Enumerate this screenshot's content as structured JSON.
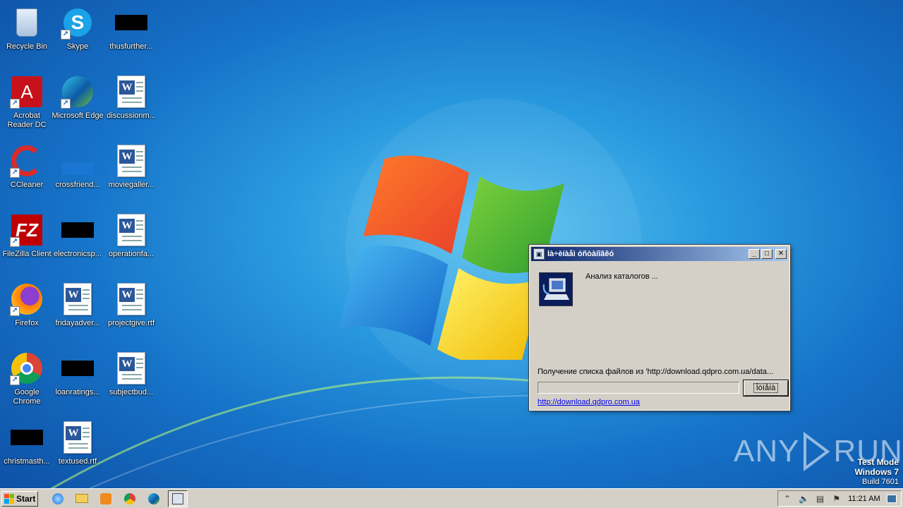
{
  "desktop": {
    "icons": [
      {
        "label": "Recycle Bin",
        "icon": "recycle-bin-icon"
      },
      {
        "label": "Skype",
        "icon": "skype-icon"
      },
      {
        "label": "thusfurther...",
        "icon": "blacked-out-file-icon"
      },
      {
        "label": "Acrobat Reader DC",
        "icon": "acrobat-icon"
      },
      {
        "label": "Microsoft Edge",
        "icon": "edge-icon"
      },
      {
        "label": "discussionm...",
        "icon": "word-doc-icon"
      },
      {
        "label": "CCleaner",
        "icon": "ccleaner-icon"
      },
      {
        "label": "crossfriend...",
        "icon": "folder-icon"
      },
      {
        "label": "moviegaller...",
        "icon": "word-doc-icon"
      },
      {
        "label": "FileZilla Client",
        "icon": "filezilla-icon"
      },
      {
        "label": "electronicsp...",
        "icon": "blacked-out-file-icon"
      },
      {
        "label": "operationfa...",
        "icon": "word-doc-icon"
      },
      {
        "label": "Firefox",
        "icon": "firefox-icon"
      },
      {
        "label": "fridayadver...",
        "icon": "word-doc-icon"
      },
      {
        "label": "projectgive.rtf",
        "icon": "word-doc-icon"
      },
      {
        "label": "Google Chrome",
        "icon": "chrome-icon"
      },
      {
        "label": "loanratings...",
        "icon": "blacked-out-file-icon"
      },
      {
        "label": "subjectbud...",
        "icon": "word-doc-icon"
      },
      {
        "label": "christmasth...",
        "icon": "blacked-out-file-icon"
      },
      {
        "label": "textused.rtf",
        "icon": "word-doc-icon"
      }
    ]
  },
  "dialog": {
    "title": "Íà÷èíàåì óñòàíîâêó",
    "status": "Анализ каталогов ...",
    "progress_label": "Получение списка файлов из 'http://download.qdpro.com.ua/data...",
    "progress_fraction": 0,
    "cancel_label": "Îòìåíà",
    "link": "http://download.qdpro.com.ua",
    "buttons": {
      "minimize": "_",
      "maximize": "□",
      "close": "✕"
    }
  },
  "watermark": {
    "left": "ANY",
    "right": "RUN"
  },
  "testmode": {
    "line1": "Test Mode",
    "line2": "Windows 7",
    "line3": "Build 7601"
  },
  "taskbar": {
    "start_label": "Start",
    "quick_launch": [
      "ie-icon",
      "explorer-icon",
      "media-player-icon",
      "chrome-icon",
      "edge-icon",
      "installer-icon"
    ],
    "clock": "11:21 AM",
    "colors": {
      "start_flag": [
        "#f25022",
        "#7fba00",
        "#00a4ef",
        "#ffb900"
      ]
    }
  }
}
